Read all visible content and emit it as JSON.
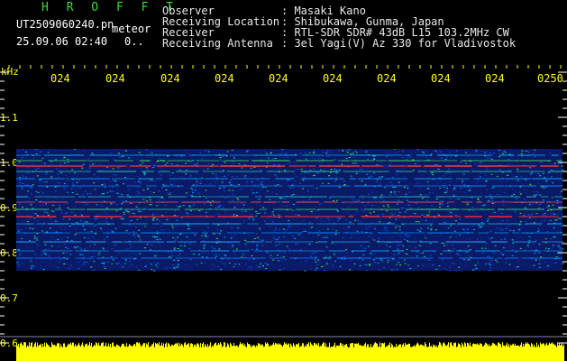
{
  "header": {
    "app_title": "H R O F F T",
    "filename": "UT2509060240.pn",
    "mode": "meteor",
    "datetime": "25.09.06 02:40",
    "status": "0..",
    "info": [
      {
        "label": "Observer",
        "value": ": Masaki Kano"
      },
      {
        "label": "Receiving Location",
        "value": ": Shibukawa, Gunma, Japan"
      },
      {
        "label": "Receiver",
        "value": ": RTL-SDR SDR# 43dB L15 103.2MHz CW"
      },
      {
        "label": "Receiving Antenna",
        "value": ": 3el Yagi(V) Az 330 for Vladivostok"
      }
    ]
  },
  "axis": {
    "unit": "kHz",
    "y_ticks": [
      "1.1",
      "1.0",
      "0.9",
      "0.8",
      "0.7",
      "0.6"
    ],
    "x_ticks": [
      "024",
      "024",
      "024",
      "024",
      "024",
      "024",
      "024",
      "024",
      "024",
      "0250"
    ]
  },
  "colors": {
    "background": "#000000",
    "label_yellow": "#ffff00",
    "title_green": "#33dd33"
  }
}
